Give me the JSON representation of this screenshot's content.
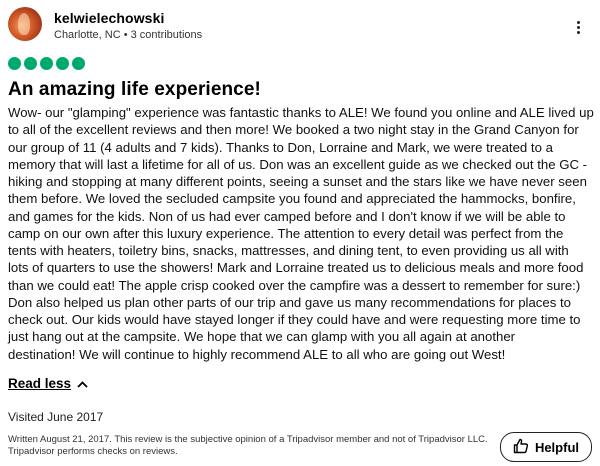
{
  "reviewer": {
    "username": "kelwielechowski",
    "location_contributions": "Charlotte, NC • 3 contributions"
  },
  "rating": {
    "value": 5,
    "max": 5,
    "color": "#00aa6c"
  },
  "review": {
    "title": "An amazing life experience!",
    "body": "Wow- our \"glamping\" experience was fantastic thanks to ALE! We found you online and ALE lived up\nto all of the excellent reviews and then more! We booked a two night stay in the Grand Canyon for\nour group of 11 (4 adults and 7 kids). Thanks to Don, Lorraine and Mark, we were treated to a\nmemory that will last a lifetime for all of us. Don was an excellent guide as we checked out the GC -\nhiking and stopping at many different points, seeing a sunset and the stars like we have never seen\nthem before. We loved the secluded campsite you found and appreciated the hammocks, bonfire,\nand games for the kids. Non of us had ever camped before and I don't know if we will be able to\ncamp on our own after this luxury experience. The attention to every detail was perfect from the\ntents with heaters, toiletry bins, snacks, mattresses, and dining tent, to even providing us all with\nlots of quarters to use the showers! Mark and Lorraine treated us to delicious meals and more food\nthan we could eat! The apple crisp cooked over the campfire was a dessert to remember for sure:)\nDon also helped us plan other parts of our trip and gave us many recommendations for places to\ncheck out. Our kids would have stayed longer if they could have and were requesting more time to\njust hang out at the campsite. We hope that we can glamp with you all again at another\ndestination! We will continue to highly recommend ALE to all who are going out West!",
    "read_less_label": "Read less",
    "visited": "Visited June 2017",
    "disclaimer": "Written August 21, 2017. This review is the subjective opinion of a Tripadvisor member and not of Tripadvisor LLC. Tripadvisor performs checks on reviews."
  },
  "actions": {
    "helpful_label": "Helpful"
  },
  "icons": {
    "more": "more-vertical-icon",
    "chevron": "chevron-up-icon",
    "thumb": "thumbs-up-icon"
  }
}
